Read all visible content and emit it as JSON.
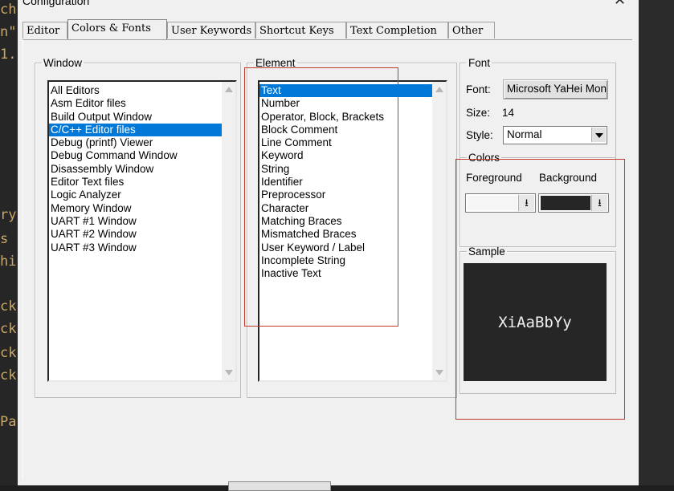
{
  "window": {
    "title": "Configuration"
  },
  "editor_fragments": [
    "ch",
    "n\"",
    "1.",
    "ry",
    "s",
    "hi",
    "ck",
    "ck",
    "ck",
    "ck",
    "Pa"
  ],
  "tabs": [
    {
      "label": "Editor",
      "active": false
    },
    {
      "label": "Colors & Fonts",
      "active": true
    },
    {
      "label": "User Keywords",
      "active": false
    },
    {
      "label": "Shortcut Keys",
      "active": false
    },
    {
      "label": "Text Completion",
      "active": false
    },
    {
      "label": "Other",
      "active": false
    }
  ],
  "window_group": {
    "legend": "Window",
    "items": [
      "All Editors",
      "Asm Editor files",
      "Build Output Window",
      "C/C++ Editor files",
      "Debug (printf) Viewer",
      "Debug Command Window",
      "Disassembly Window",
      "Editor Text files",
      "Logic Analyzer",
      "Memory Window",
      "UART #1 Window",
      "UART #2 Window",
      "UART #3 Window"
    ],
    "selected": "C/C++ Editor files"
  },
  "element_group": {
    "legend": "Element",
    "items": [
      "Text",
      "Number",
      "Operator, Block, Brackets",
      "Block Comment",
      "Line Comment",
      "Keyword",
      "String",
      "Identifier",
      "Preprocessor",
      "Character",
      "Matching Braces",
      "Mismatched Braces",
      "User Keyword / Label",
      "Incomplete String",
      "Inactive Text"
    ],
    "selected": "Text"
  },
  "font_group": {
    "legend": "Font",
    "font_label": "Font:",
    "font_value": "Microsoft YaHei Mon",
    "size_label": "Size:",
    "size_value": "14",
    "style_label": "Style:",
    "style_value": "Normal"
  },
  "colors_group": {
    "legend": "Colors",
    "foreground_label": "Foreground",
    "background_label": "Background",
    "foreground_color": "#f5f5f5",
    "background_color": "#262626"
  },
  "sample_group": {
    "legend": "Sample",
    "text": "XiAaBbYy",
    "bg_color": "#262626",
    "fg_color": "#f0f0f0"
  },
  "annotation_color": "#c0392b"
}
